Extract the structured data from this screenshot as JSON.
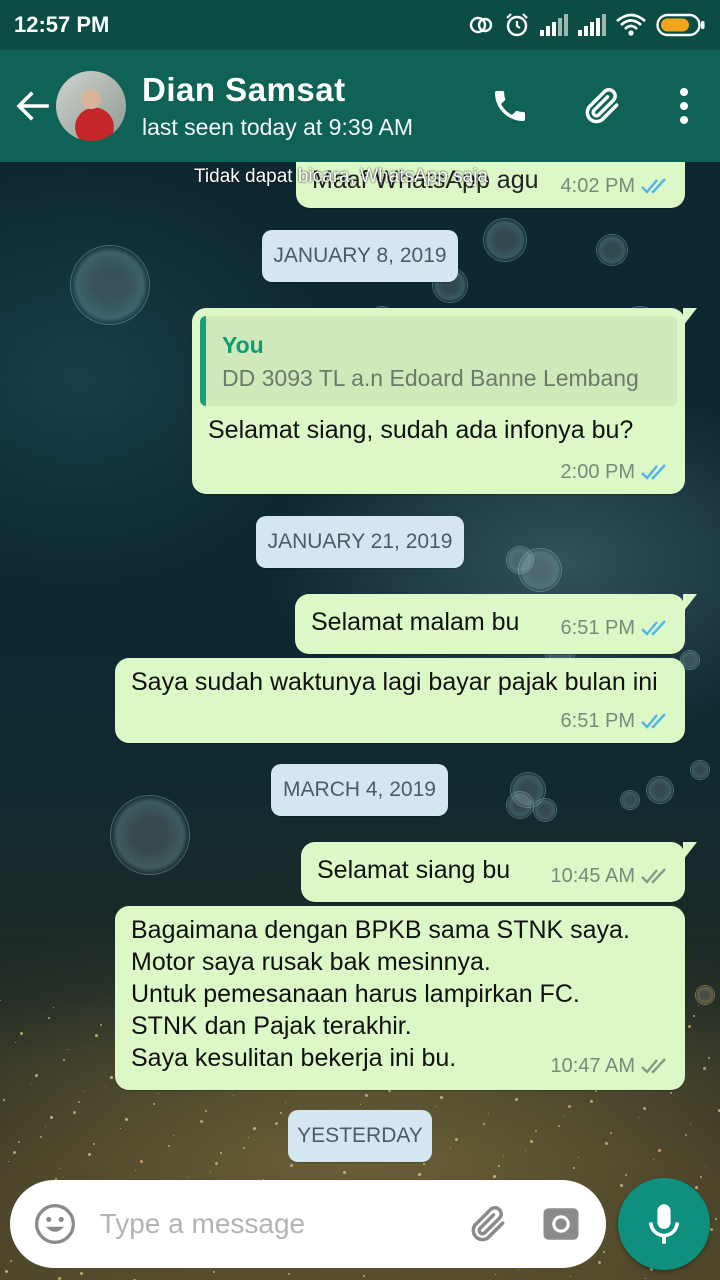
{
  "status_bar": {
    "time": "12:57 PM",
    "icons": [
      "sync-icon",
      "alarm-icon",
      "signal-icon",
      "signal-icon",
      "wifi-icon",
      "battery-icon"
    ]
  },
  "header": {
    "contact_name": "Dian Samsat",
    "contact_status": "last seen today at 9:39 AM",
    "icons": [
      "back-arrow-icon",
      "avatar",
      "phone-icon",
      "paperclip-icon",
      "more-vert-icon"
    ]
  },
  "overlay_banner": "Tidak dapat bicara, WhatsApp saja",
  "chat": {
    "partial_message": {
      "text": "Maaf WhatsApp agu",
      "time": "4:02 PM",
      "status": "read"
    },
    "dates": [
      "JANUARY 8, 2019",
      "JANUARY 21, 2019",
      "MARCH 4, 2019",
      "YESTERDAY"
    ],
    "messages": [
      {
        "quote_author": "You",
        "quote_text": "DD 3093 TL a.n Edoard Banne Lembang",
        "text": "Selamat siang, sudah ada infonya bu?",
        "time": "2:00 PM",
        "status": "read"
      },
      {
        "text": "Selamat malam bu",
        "time": "6:51 PM",
        "status": "read"
      },
      {
        "text": "Saya sudah waktunya lagi bayar pajak bulan ini",
        "time": "6:51 PM",
        "status": "read"
      },
      {
        "text": "Selamat siang bu",
        "time": "10:45 AM",
        "status": "delivered"
      },
      {
        "lines": [
          "Bagaimana dengan BPKB sama STNK saya.",
          "Motor saya rusak bak mesinnya.",
          "Untuk pemesanaan harus lampirkan FC.",
          "STNK dan Pajak terakhir.",
          "Saya kesulitan bekerja ini bu."
        ],
        "time": "10:47 AM",
        "status": "delivered"
      }
    ]
  },
  "input": {
    "placeholder": "Type a message",
    "icons": [
      "emoji-icon",
      "paperclip-icon",
      "camera-icon",
      "mic-icon"
    ]
  },
  "colors": {
    "header": "#0f6356",
    "status_bar": "#0b4d43",
    "bubble": "#dcf8c6",
    "read_ticks": "#4fb6ec",
    "delivered_ticks": "#8a9a88",
    "date_chip": "#d4e6f0",
    "mic_button": "#0f8f7d"
  }
}
